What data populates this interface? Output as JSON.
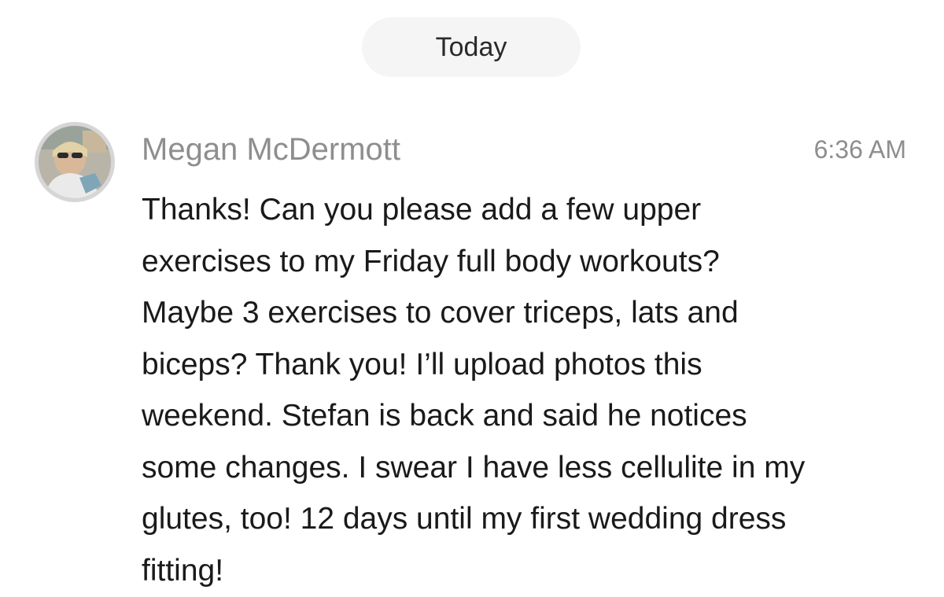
{
  "date_separator": "Today",
  "message": {
    "avatar_icon": "user-photo-avatar",
    "sender": "Megan McDermott",
    "time": "6:36 AM",
    "text": "Thanks! Can you please add a few upper\nexercises to my Friday full body workouts?\nMaybe 3 exercises to cover triceps, lats and\nbiceps? Thank you! I’ll upload photos this\nweekend. Stefan is back and said he notices\nsome changes. I swear I have less cellulite in my\nglutes, too! 12 days until my first wedding dress\nfitting!"
  }
}
